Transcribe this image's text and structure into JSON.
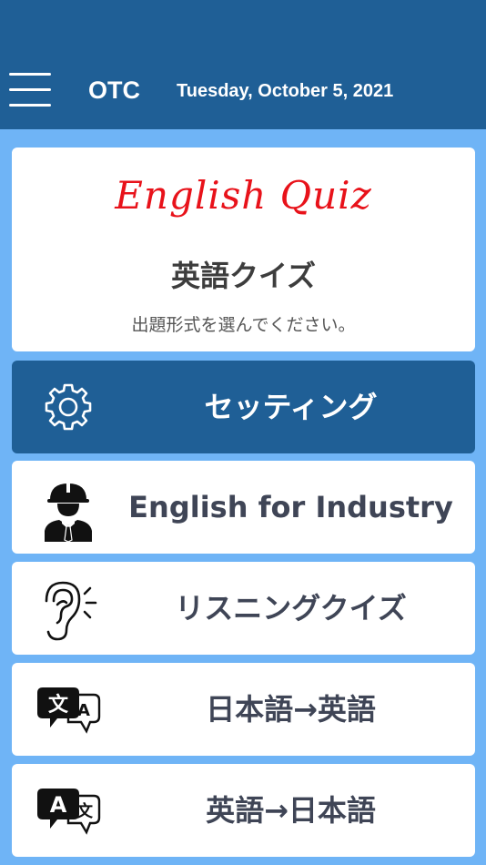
{
  "header": {
    "app_name": "OTC",
    "date": "Tuesday, October 5, 2021"
  },
  "intro": {
    "title": "English Quiz",
    "subtitle": "英語クイズ",
    "instruction": "出題形式を選んでください。"
  },
  "menu": [
    {
      "label": "セッティング",
      "icon": "gear-icon"
    },
    {
      "label": "English for Industry",
      "icon": "worker-icon"
    },
    {
      "label": "リスニングクイズ",
      "icon": "ear-icon"
    },
    {
      "label": "日本語→英語",
      "icon": "translate-ja-en-icon"
    },
    {
      "label": "英語→日本語",
      "icon": "translate-en-ja-icon"
    }
  ],
  "colors": {
    "header": "#1f5f96",
    "background": "#6fb4f6",
    "title_red": "#e8121a",
    "label_text": "#3f4556"
  }
}
